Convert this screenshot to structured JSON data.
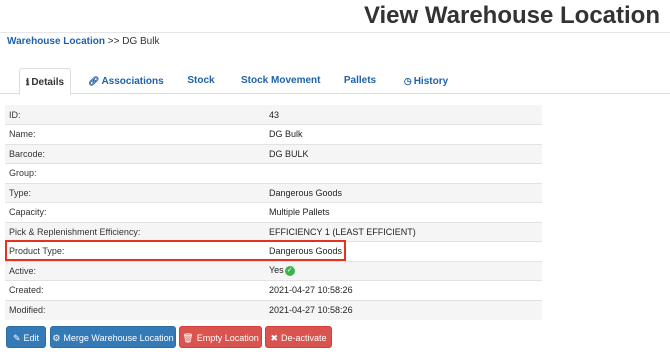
{
  "header": {
    "title": "View Warehouse Location"
  },
  "breadcrumb": {
    "parent": "Warehouse Location",
    "separator": ">>",
    "current": "DG Bulk"
  },
  "tabs": [
    {
      "label": "Details",
      "icon": "info-icon",
      "active": true
    },
    {
      "label": "Associations",
      "icon": "link-icon",
      "active": false
    },
    {
      "label": "Stock",
      "active": false
    },
    {
      "label": "Stock Movement",
      "active": false
    },
    {
      "label": "Pallets",
      "active": false
    },
    {
      "label": "History",
      "icon": "clock-icon",
      "active": false
    }
  ],
  "details": {
    "rows": [
      {
        "label": "ID:",
        "value": "43"
      },
      {
        "label": "Name:",
        "value": "DG Bulk"
      },
      {
        "label": "Barcode:",
        "value": "DG BULK"
      },
      {
        "label": "Group:",
        "value": ""
      },
      {
        "label": "Type:",
        "value": "Dangerous Goods"
      },
      {
        "label": "Capacity:",
        "value": "Multiple Pallets"
      },
      {
        "label": "Pick & Replenishment Efficiency:",
        "value": "EFFICIENCY 1 (LEAST EFFICIENT)"
      },
      {
        "label": "Product Type:",
        "value": "Dangerous Goods"
      },
      {
        "label": "Active:",
        "value": "Yes"
      },
      {
        "label": "Created:",
        "value": "2021-04-27 10:58:26"
      },
      {
        "label": "Modified:",
        "value": "2021-04-27 10:58:26"
      }
    ]
  },
  "actions": {
    "edit": "Edit",
    "merge": "Merge Warehouse Location",
    "empty": "Empty Location",
    "deactivate": "De-activate"
  },
  "colors": {
    "link": "#1f62a8",
    "primary_button": "#337ab7",
    "danger_button": "#d9534f",
    "highlight_box": "#e0341f",
    "check_green": "#3bb54a"
  }
}
